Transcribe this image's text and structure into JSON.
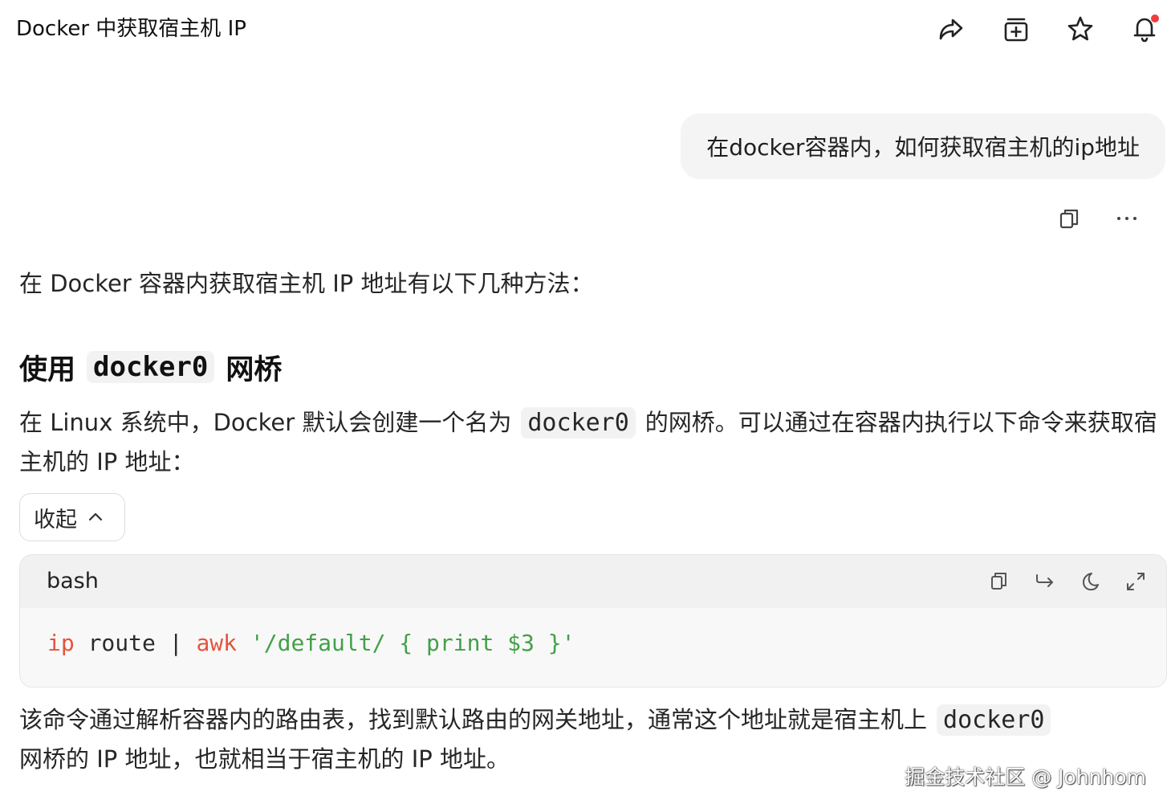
{
  "header": {
    "title": "Docker 中获取宿主机 IP",
    "actions": [
      {
        "icon": "share-icon"
      },
      {
        "icon": "add-to-collection-icon"
      },
      {
        "icon": "star-icon"
      },
      {
        "icon": "bell-icon",
        "has_notification": true
      }
    ]
  },
  "user_message": {
    "text": "在docker容器内，如何获取宿主机的ip地址",
    "actions": [
      {
        "icon": "copy-icon"
      },
      {
        "icon": "more-icon"
      }
    ]
  },
  "answer": {
    "intro": "在 Docker 容器内获取宿主机 IP 地址有以下几种方法：",
    "section_heading": {
      "prefix": "使用",
      "code": "docker0",
      "suffix": "网桥"
    },
    "para2": {
      "text_before": "在 Linux 系统中，Docker 默认会创建一个名为",
      "code": "docker0",
      "text_after": "的网桥。可以通过在容器内执行以下命令来获取宿主机的 IP 地址："
    },
    "collapse_label": "收起",
    "code_block": {
      "language": "bash",
      "tokens": {
        "cmd1": "ip",
        "arg1": " route | ",
        "cmd2": "awk",
        "str": " '/default/ { print $3 }'"
      },
      "tools": [
        "copy-icon",
        "wrap-icon",
        "theme-icon",
        "expand-icon"
      ]
    },
    "para3": {
      "text_before": "该命令通过解析容器内的路由表，找到默认路由的网关地址，通常这个地址就是宿主机上",
      "code": "docker0",
      "text_after": "网桥的 IP 地址，也就相当于宿主机的 IP 地址。"
    }
  },
  "watermark": "掘金技术社区 @ Johnhom",
  "colors": {
    "accent_red": "#f23b3b",
    "code_cmd": "#e5533d",
    "code_string": "#43a047"
  }
}
